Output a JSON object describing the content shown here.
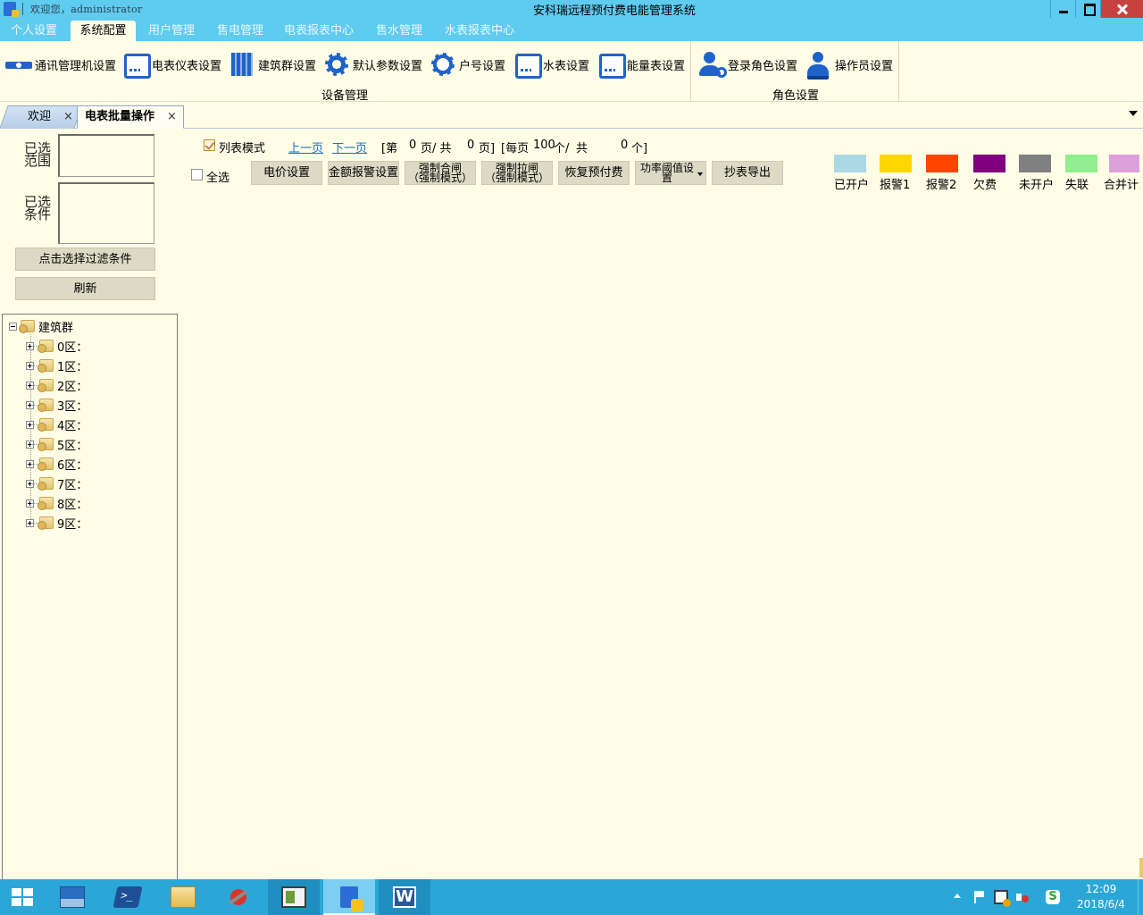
{
  "titlebar": {
    "welcome": "欢迎您，administrator",
    "title": "安科瑞远程预付费电能管理系统"
  },
  "menu": {
    "tabs": [
      {
        "label": "个人设置",
        "active": false
      },
      {
        "label": "系统配置",
        "active": true
      },
      {
        "label": "用户管理",
        "active": false
      },
      {
        "label": "售电管理",
        "active": false
      },
      {
        "label": "电表报表中心",
        "active": false
      },
      {
        "label": "售水管理",
        "active": false
      },
      {
        "label": "水表报表中心",
        "active": false
      }
    ]
  },
  "ribbon": {
    "groups": [
      {
        "label": "设备管理",
        "items": [
          {
            "label": "通讯管理机设置",
            "icon": "comm-manager-icon"
          },
          {
            "label": "电表仪表设置",
            "icon": "meter-screen-icon"
          },
          {
            "label": "建筑群设置",
            "icon": "building-icon"
          },
          {
            "label": "默认参数设置",
            "icon": "gear-icon"
          },
          {
            "label": "户号设置",
            "icon": "house-gear-icon"
          },
          {
            "label": "水表设置",
            "icon": "water-meter-icon"
          },
          {
            "label": "能量表设置",
            "icon": "energy-meter-icon"
          }
        ]
      },
      {
        "label": "角色设置",
        "items": [
          {
            "label": "登录角色设置",
            "icon": "user-gear-icon"
          },
          {
            "label": "操作员设置",
            "icon": "operator-icon"
          }
        ]
      }
    ]
  },
  "doc_tabs": [
    {
      "label": "欢迎",
      "active": false,
      "close": "×"
    },
    {
      "label": "电表批量操作",
      "active": true,
      "close": "×"
    }
  ],
  "filter": {
    "range_label": "已选范围",
    "range_label_lines": [
      "已选",
      "范围"
    ],
    "condition_label_lines": [
      "已选",
      "条件"
    ],
    "choose_filter_button": "点击选择过滤条件",
    "refresh_button": "刷新"
  },
  "tree": {
    "root": "建筑群",
    "children": [
      "0区：",
      "1区：",
      "2区：",
      "3区：",
      "4区：",
      "5区：",
      "6区：",
      "7区：",
      "8区：",
      "9区："
    ]
  },
  "toolbar": {
    "list_mode_label": "列表模式",
    "list_mode_checked": true,
    "prev_page": "上一页",
    "next_page": "下一页",
    "page_info": {
      "prefix": "[第",
      "current_page": "0",
      "mid": "页/ 共",
      "total_pages": "0",
      "suffix": "页]",
      "per_page_prefix": "[每页",
      "per_page": "100",
      "per_page_suffix": "个/",
      "total_prefix": "共",
      "total": "0",
      "total_suffix": "个]"
    },
    "select_all_label": "全选",
    "select_all_checked": false,
    "buttons": [
      {
        "label": "电价设置"
      },
      {
        "label": "金额报警设置"
      },
      {
        "label_lines": [
          "强制合闸",
          "（强制模式）"
        ]
      },
      {
        "label_lines": [
          "强制拉闸",
          "（强制模式）"
        ]
      },
      {
        "label": "恢复预付费"
      },
      {
        "label_lines": [
          "功率阈值设",
          "置"
        ],
        "dropdown": true
      },
      {
        "label": "抄表导出"
      }
    ]
  },
  "legend": [
    {
      "label": "已开户",
      "color": "#acd8e6"
    },
    {
      "label": "报警1",
      "color": "#ffd700"
    },
    {
      "label": "报警2",
      "color": "#ff4500"
    },
    {
      "label": "欠费",
      "color": "#800080"
    },
    {
      "label": "未开户",
      "color": "#808080"
    },
    {
      "label": "失联",
      "color": "#90ee90"
    },
    {
      "label": "合并计量",
      "color": "#dda0dd"
    }
  ],
  "taskbar": {
    "apps": [
      "start-icon",
      "server-manager-icon",
      "powershell-icon",
      "file-explorer-icon",
      "tools-icon",
      "document-viewer-icon",
      "prepaid-app-icon",
      "word-icon"
    ],
    "tray_s_label": "S",
    "clock_time": "12:09",
    "clock_date": "2018/6/4"
  }
}
